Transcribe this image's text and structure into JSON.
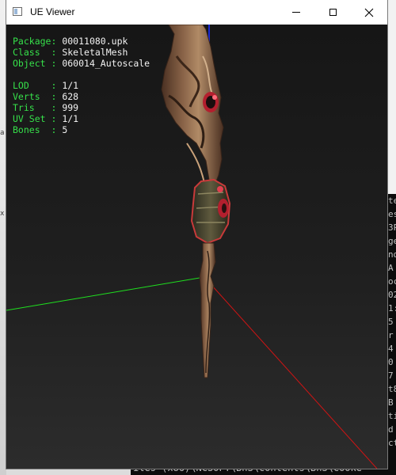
{
  "window": {
    "title": "UE Viewer",
    "minimize_glyph": "minimize-icon",
    "maximize_glyph": "maximize-icon",
    "close_glyph": "✕"
  },
  "info_panel": {
    "package": {
      "label": "Package:",
      "value": "00011080.upk"
    },
    "class": {
      "label": "Class  :",
      "value": "SkeletalMesh"
    },
    "object": {
      "label": "Object :",
      "value": "060014_Autoscale"
    },
    "lod": {
      "label": "LOD    :",
      "value": "1/1"
    },
    "verts": {
      "label": "Verts  :",
      "value": "628"
    },
    "tris": {
      "label": "Tris   :",
      "value": "999"
    },
    "uvset": {
      "label": "UV Set :",
      "value": "1/1"
    },
    "bones": {
      "label": "Bones  :",
      "value": "5"
    }
  },
  "background_console": {
    "right_column": [
      "te",
      "es",
      "3P",
      "ge",
      "nd",
      "A",
      "oc",
      "02",
      "1:",
      "5",
      "r",
      "4",
      "0",
      "7",
      "t8",
      "B",
      "ti",
      "d",
      "ct"
    ],
    "bottom_line": "iles (x86)\\NCSOFT\\BnS\\contents\\BnS\\Cooke"
  },
  "colors": {
    "label_green": "#36e04a",
    "value_white": "#f2f2f2",
    "axis_x": "#d01414",
    "axis_y": "#1fe01f",
    "axis_z": "#1a2ad6",
    "mesh_brown": "#6b4a36",
    "accent_red": "#c8303a"
  }
}
